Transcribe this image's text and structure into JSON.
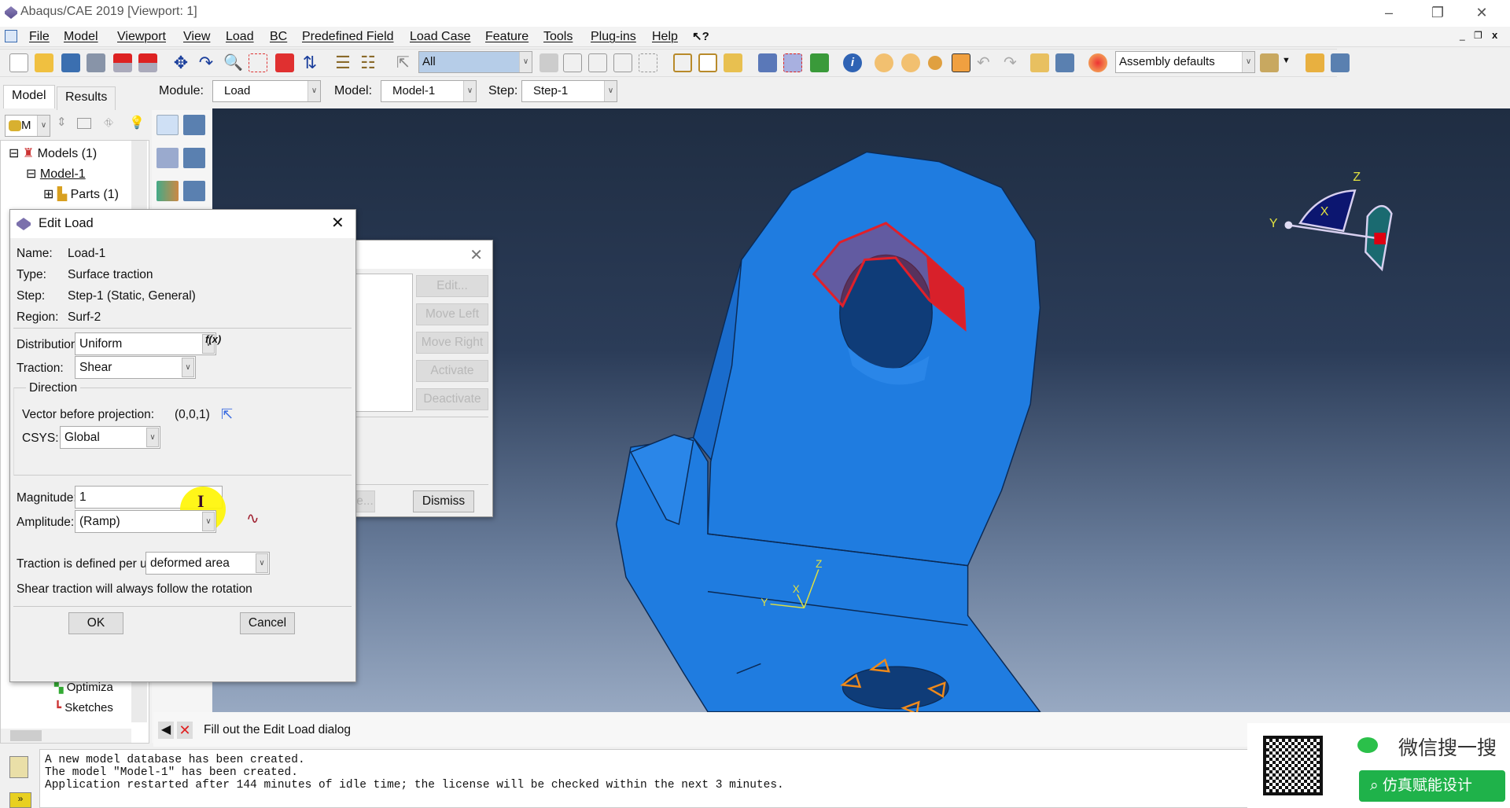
{
  "window": {
    "title": "Abaqus/CAE 2019 [Viewport: 1]",
    "controls": [
      "minimize",
      "restore",
      "close"
    ]
  },
  "menu": [
    "File",
    "Model",
    "Viewport",
    "View",
    "Load",
    "BC",
    "Predefined Field",
    "Load Case",
    "Feature",
    "Tools",
    "Plug-ins",
    "Help"
  ],
  "toolbar": {
    "selection_filter": "All",
    "render_style": "Assembly defaults"
  },
  "tabs": [
    "Model",
    "Results"
  ],
  "context": {
    "module_label": "Module:",
    "module": "Load",
    "model_label": "Model:",
    "model": "Model-1",
    "step_label": "Step:",
    "step": "Step-1"
  },
  "tree": {
    "combo": "M",
    "items": [
      {
        "label": "Models (1)"
      },
      {
        "label": "Model-1"
      },
      {
        "label": "Parts (1)"
      },
      {
        "label": "Optimiza"
      },
      {
        "label": "Sketches"
      }
    ]
  },
  "edit_load": {
    "title": "Edit Load",
    "name_label": "Name:",
    "name": "Load-1",
    "type_label": "Type:",
    "type": "Surface traction",
    "step_label": "Step:",
    "step": "Step-1 (Static, General)",
    "region_label": "Region:",
    "region": "Surf-2",
    "distribution_label": "Distribution:",
    "distribution": "Uniform",
    "fx": "f(x)",
    "traction_label": "Traction:",
    "traction": "Shear",
    "direction_group": "Direction",
    "vector_label": "Vector before projection:",
    "vector": "(0,0,1)",
    "csys_label": "CSYS:",
    "csys": "Global",
    "magnitude_label": "Magnitude:",
    "magnitude": "1",
    "amplitude_label": "Amplitude:",
    "amplitude": "(Ramp)",
    "per_unit_label": "Traction is defined per unit",
    "per_unit": "deformed area",
    "note": "Shear traction will always follow the rotation",
    "ok": "OK",
    "cancel": "Cancel"
  },
  "load_manager": {
    "buttons": [
      "Edit...",
      "Move Left",
      "Move Right",
      "Activate",
      "Deactivate"
    ],
    "partial_button": "e...",
    "dismiss": "Dismiss"
  },
  "triad": {
    "x": "X",
    "y": "Y",
    "z": "Z"
  },
  "csys_marker": {
    "x": "X",
    "y": "Y",
    "z": "Z"
  },
  "prompt": "Fill out the Edit Load dialog",
  "messages": [
    "A new model database has been created.",
    "The model \"Model-1\" has been created.",
    "Application restarted after 144 minutes of idle time; the license will be checked within the next 3 minutes."
  ],
  "watermark": {
    "search_title": "微信搜一搜",
    "account": "仿真赋能设计"
  },
  "colors": {
    "part": "#1f7ce0",
    "selected_surface": "#e0202a",
    "viewport_top": "#1f2d42",
    "viewport_bottom": "#98a9c2",
    "load_arrows": "#f08a1a"
  }
}
